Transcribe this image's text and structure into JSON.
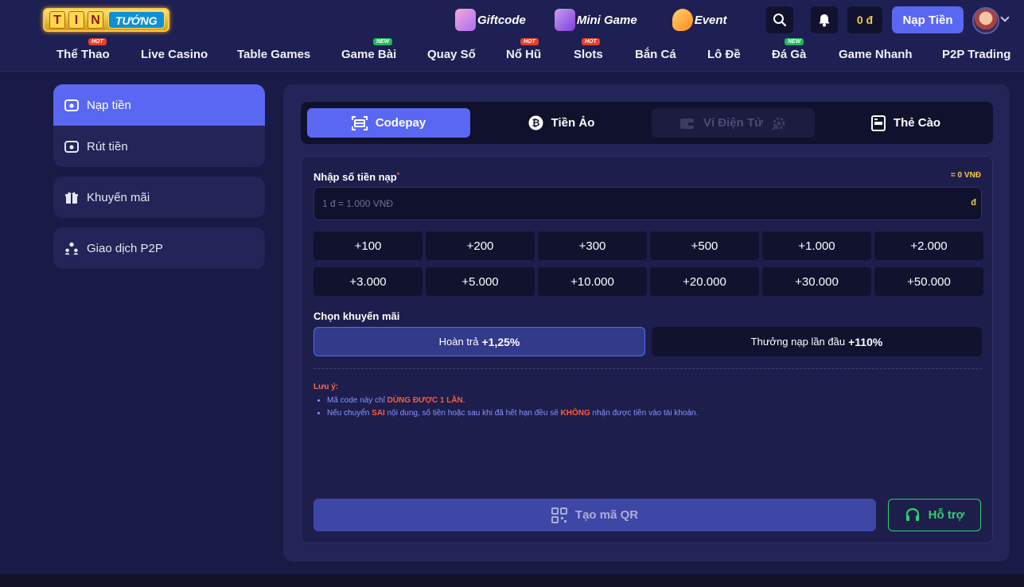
{
  "brand": {
    "logo_letters": [
      "T",
      "I",
      "N"
    ],
    "logo_word": "TƯỚNG"
  },
  "top_links": [
    {
      "label": "Giftcode",
      "icon": "gift-icon"
    },
    {
      "label": "Mini Game",
      "icon": "slot-machine-icon"
    },
    {
      "label": "Event",
      "icon": "megaphone-icon"
    }
  ],
  "header": {
    "balance": "0 đ",
    "deposit_label": "Nạp Tiền"
  },
  "nav": [
    {
      "label": "Thể Thao",
      "badge": "HOT"
    },
    {
      "label": "Live Casino",
      "badge": ""
    },
    {
      "label": "Table Games",
      "badge": ""
    },
    {
      "label": "Game Bài",
      "badge": "NEW"
    },
    {
      "label": "Quay Số",
      "badge": ""
    },
    {
      "label": "Nổ Hũ",
      "badge": "HOT"
    },
    {
      "label": "Slots",
      "badge": "HOT"
    },
    {
      "label": "Bắn Cá",
      "badge": ""
    },
    {
      "label": "Lô Đề",
      "badge": ""
    },
    {
      "label": "Đá Gà",
      "badge": "NEW"
    },
    {
      "label": "Game Nhanh",
      "badge": ""
    },
    {
      "label": "P2P Trading",
      "badge": ""
    }
  ],
  "sidebar": {
    "deposit": "Nạp tiền",
    "withdraw": "Rút tiền",
    "promotions": "Khuyến mãi",
    "p2p": "Giao dịch P2P"
  },
  "tabs": [
    {
      "label": "Codepay",
      "state": "active"
    },
    {
      "label": "Tiền Ảo",
      "state": "normal"
    },
    {
      "label": "Ví Điện Tử",
      "state": "disabled"
    },
    {
      "label": "Thẻ Cào",
      "state": "normal"
    }
  ],
  "form": {
    "amount_label": "Nhập số tiền nạp",
    "required_mark": "*",
    "rate_text": "= 0 VNĐ",
    "amount_placeholder": "1 đ = 1.000 VNĐ",
    "amount_value": "",
    "currency": "đ",
    "quick_amounts": [
      "+100",
      "+200",
      "+300",
      "+500",
      "+1.000",
      "+2.000",
      "+3.000",
      "+5.000",
      "+10.000",
      "+20.000",
      "+30.000",
      "+50.000"
    ],
    "promo_label": "Chọn khuyến mãi",
    "promos": [
      {
        "text": "Hoàn trả",
        "value": "+1,25%",
        "selected": true
      },
      {
        "text": "Thưởng nạp lần đầu",
        "value": "+110%",
        "selected": false
      }
    ]
  },
  "notes": {
    "title": "Lưu ý:",
    "line1_a": "Mã code này chỉ ",
    "line1_hl": "DÙNG ĐƯỢC 1 LẦN",
    "line1_b": ".",
    "line2_a": "Nếu chuyển ",
    "line2_hl1": "SAI",
    "line2_b": " nội dung, số tiền hoặc sau khi đã hết hạn đều sẽ ",
    "line2_hl2": "KHÔNG",
    "line2_c": " nhận được tiền vào tài khoản."
  },
  "actions": {
    "qr_label": "Tạo mã QR",
    "support_label": "Hỗ trợ"
  },
  "colors": {
    "accent": "#5a67f2",
    "gold": "#f4c94e",
    "support_green": "#2fcf6e",
    "warning_red": "#ff5a3a"
  }
}
